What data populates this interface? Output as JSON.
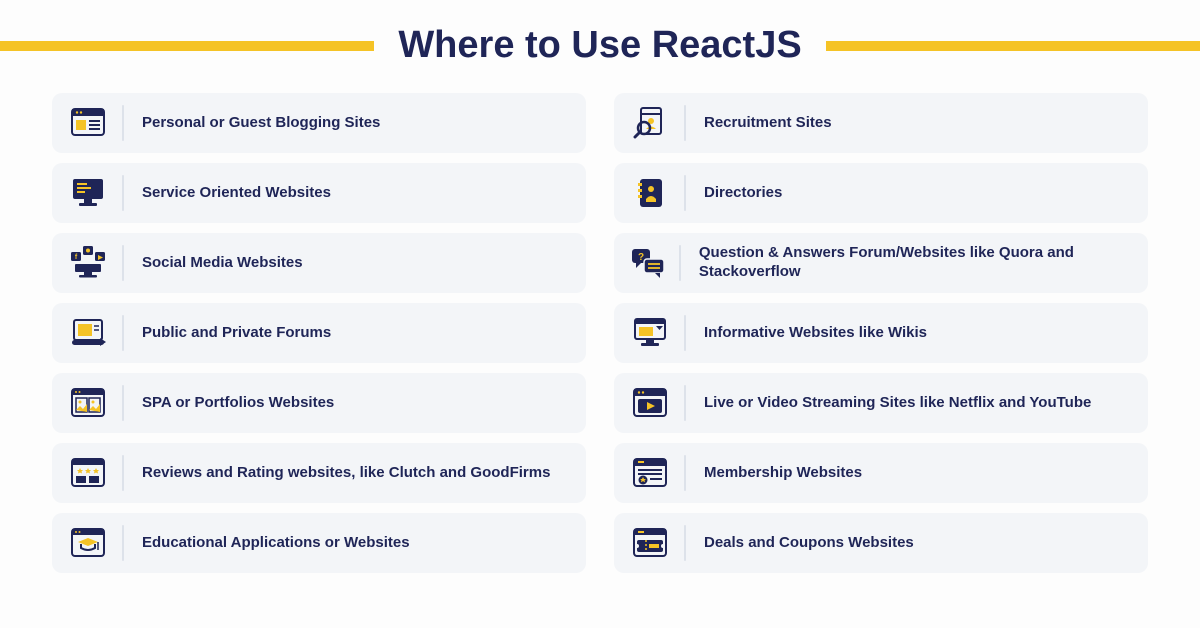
{
  "title": "Where to Use ReactJS",
  "colors": {
    "navy": "#1f2557",
    "gold": "#f5c326",
    "cardBg": "#f3f5f8"
  },
  "items": {
    "left": [
      {
        "icon": "browser-lines-icon",
        "label": "Personal or Guest Blogging Sites"
      },
      {
        "icon": "monitor-code-icon",
        "label": "Service Oriented Websites"
      },
      {
        "icon": "social-media-icon",
        "label": "Social Media Websites"
      },
      {
        "icon": "forum-slide-icon",
        "label": "Public and Private Forums"
      },
      {
        "icon": "portfolio-gallery-icon",
        "label": "SPA or Portfolios Websites"
      },
      {
        "icon": "reviews-stars-icon",
        "label": "Reviews and Rating websites, like Clutch and GoodFirms"
      },
      {
        "icon": "education-cap-icon",
        "label": "Educational Applications or Websites"
      }
    ],
    "right": [
      {
        "icon": "resume-search-icon",
        "label": "Recruitment Sites"
      },
      {
        "icon": "directory-book-icon",
        "label": "Directories"
      },
      {
        "icon": "qa-chat-icon",
        "label": "Question & Answers Forum/Websites like Quora and Stackoverflow"
      },
      {
        "icon": "wiki-monitor-icon",
        "label": "Informative Websites like Wikis"
      },
      {
        "icon": "video-play-icon",
        "label": "Live or Video Streaming Sites like Netflix and YouTube"
      },
      {
        "icon": "membership-star-icon",
        "label": "Membership Websites"
      },
      {
        "icon": "coupon-ticket-icon",
        "label": "Deals and Coupons Websites"
      }
    ]
  }
}
